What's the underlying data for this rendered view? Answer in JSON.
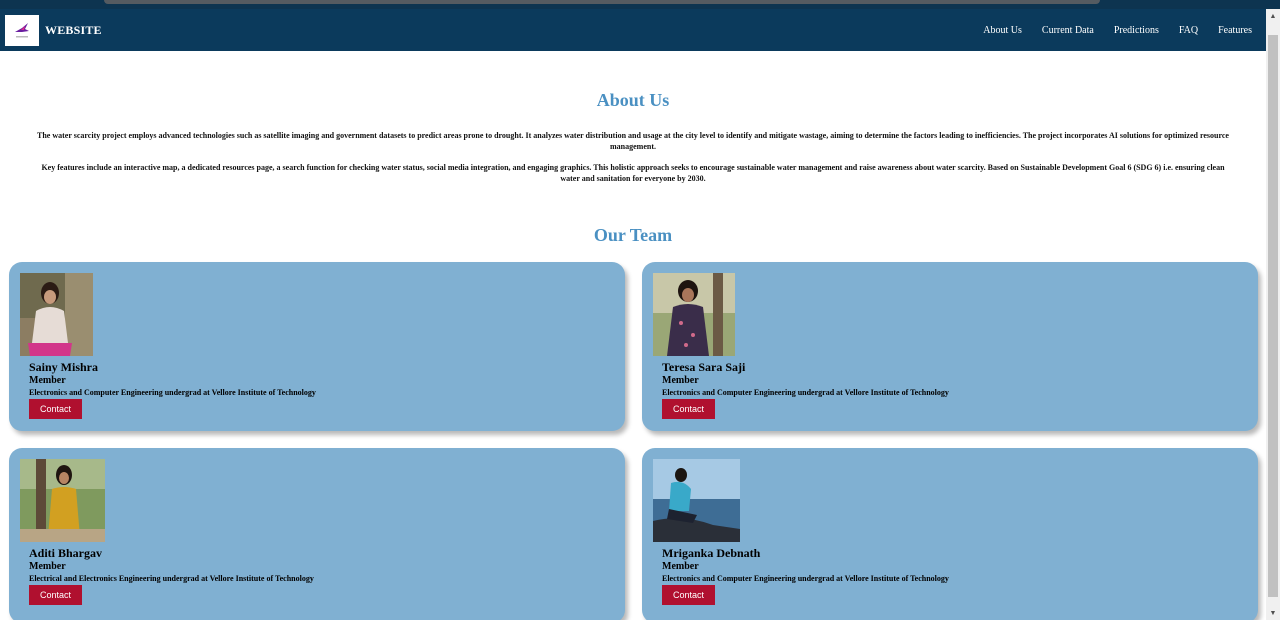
{
  "header": {
    "brand": "WEBSITE",
    "nav": [
      "About Us",
      "Current Data",
      "Predictions",
      "FAQ",
      "Features"
    ]
  },
  "about": {
    "title": "About Us",
    "p1": "The water scarcity project employs advanced technologies such as satellite imaging and government datasets to predict areas prone to drought. It analyzes water distribution and usage at the city level to identify and mitigate wastage, aiming to determine the factors leading to inefficiencies. The project incorporates AI solutions for optimized resource management.",
    "p2": "Key features include an interactive map, a dedicated resources page, a search function for checking water status, social media integration, and engaging graphics. This holistic approach seeks to encourage sustainable water management and raise awareness about water scarcity. Based on Sustainable Development Goal 6 (SDG 6) i.e. ensuring clean water and sanitation for everyone by 2030."
  },
  "team": {
    "title": "Our Team",
    "members": [
      {
        "name": "Sainy Mishra",
        "role": "Member",
        "desc": "Electronics and Computer Engineering undergrad at Vellore Institute of Technology",
        "button": "Contact"
      },
      {
        "name": "Teresa Sara Saji",
        "role": "Member",
        "desc": "Electronics and Computer Engineering undergrad at Vellore Institute of Technology",
        "button": "Contact"
      },
      {
        "name": "Aditi Bhargav",
        "role": "Member",
        "desc": "Electrical and Electronics Engineering undergrad at Vellore Institute of Technology",
        "button": "Contact"
      },
      {
        "name": "Mriganka Debnath",
        "role": "Member",
        "desc": "Electronics and Computer Engineering undergrad at Vellore Institute of Technology",
        "button": "Contact"
      }
    ]
  },
  "colors": {
    "navbar": "#0b3a5c",
    "heading": "#4a90c2",
    "card": "#80b0d2",
    "button": "#b0102f"
  }
}
